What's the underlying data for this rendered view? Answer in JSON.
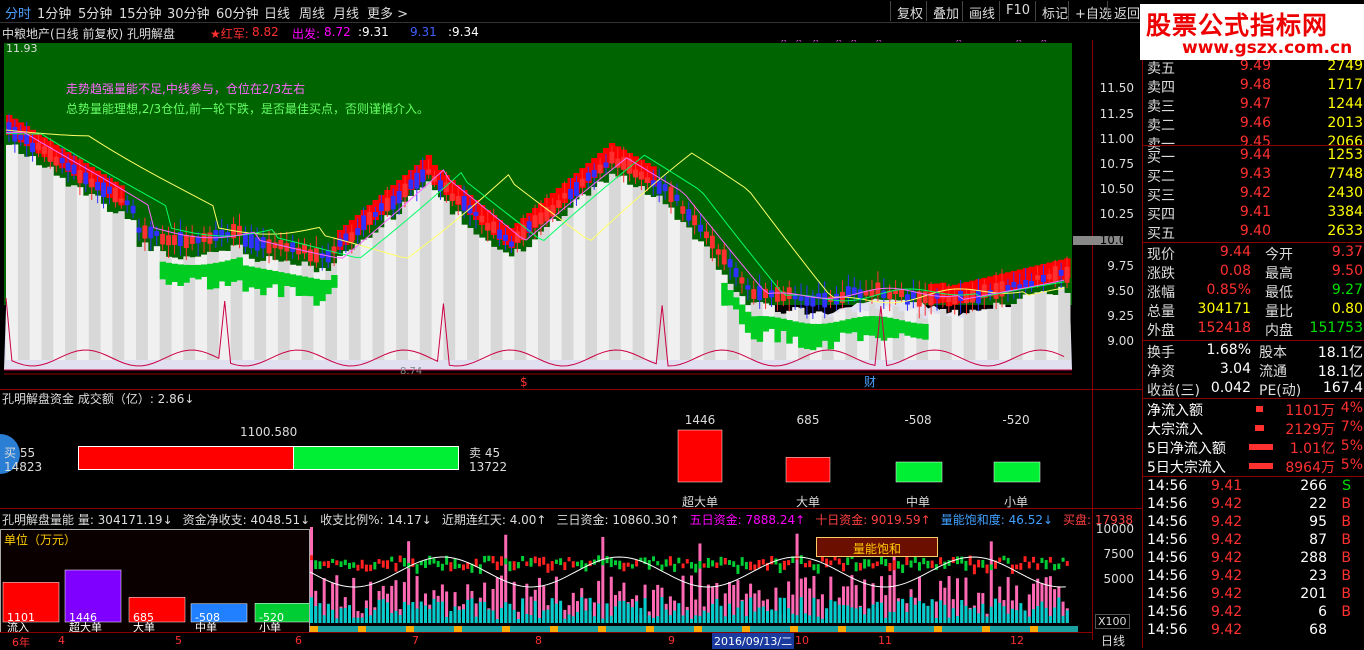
{
  "topbar": {
    "timeframes": [
      "分时",
      "1分钟",
      "5分钟",
      "15分钟",
      "30分钟",
      "60分钟",
      "日线",
      "周线",
      "月线",
      "更多 >"
    ],
    "buttons": [
      "复权",
      "叠加",
      "画线",
      "F10",
      "标记",
      "+自选",
      "返回"
    ]
  },
  "watermark": {
    "title": "股票公式指标网",
    "url": "www.gszx.com.cn"
  },
  "main": {
    "stock_name": "中粮地产(日线 前复权) 孔明解盘",
    "signal_red_label": "★红军:",
    "signal_red_value": "8.82",
    "signal_out_label": "出发:",
    "signal_out_value": "8.72",
    "v1": ":9.31",
    "v2": "9.31",
    "v3": ":9.34",
    "y_top_label": "11.93",
    "note1": "走势趋强量能不足,中线参与，仓位在2/3左右",
    "note2": "总势量能理想,2/3仓位,前一轮下跌，是否最佳买点，否则谨慎介入。",
    "price_ticks": [
      "11.50",
      "11.25",
      "11.00",
      "10.75",
      "10.50",
      "10.25",
      "10.00",
      "9.75",
      "9.50",
      "9.25",
      "9.00"
    ],
    "bottom_value": "8.74",
    "marker_s": "$",
    "marker_cai": "财"
  },
  "funds": {
    "title": "孔明解盘资金 成交额（亿）: 2.86↓",
    "buy_label": "买 55",
    "buy_value": "14823",
    "sell_label": "卖 45",
    "sell_value": "13722",
    "center_value": "1100.580",
    "bars": [
      {
        "label": "超大单",
        "value": "1446",
        "num": 1446,
        "color": "#ff0000"
      },
      {
        "label": "大单",
        "value": "685",
        "num": 685,
        "color": "#ff0000"
      },
      {
        "label": "中单",
        "value": "-508",
        "num": -508,
        "color": "#00ee33"
      },
      {
        "label": "小单",
        "value": "-520",
        "num": -520,
        "color": "#00ee33"
      }
    ]
  },
  "volume": {
    "header": [
      {
        "text": "孔明解盘量能 量: 304171.19↓",
        "color": "#ddd"
      },
      {
        "text": "资金净收支: 4048.51↓",
        "color": "#ddd"
      },
      {
        "text": "收支比例%: 14.17↓",
        "color": "#ddd"
      },
      {
        "text": "近期连红天: 4.00↑",
        "color": "#ddd"
      },
      {
        "text": "三日资金: 10860.30↑",
        "color": "#ddd"
      },
      {
        "text": "五日资金: 7888.24↑",
        "color": "#ff00ff"
      },
      {
        "text": "十日资金: 9019.59↑",
        "color": "#ff4040"
      },
      {
        "text": "量能饱和度: 46.52↓",
        "color": "#40a0ff"
      },
      {
        "text": "买盘: 17938",
        "color": "#ff4040"
      }
    ],
    "unit_label": "单位（万元）",
    "legend_bars": [
      {
        "label": "流入",
        "value": "1101",
        "color": "#ff0000",
        "num": 1101
      },
      {
        "label": "超大单",
        "value": "1446",
        "color": "#8000ff",
        "num": 1446
      },
      {
        "label": "大单",
        "value": "685",
        "color": "#ff0000",
        "num": 685
      },
      {
        "label": "中单",
        "value": "-508",
        "color": "#2080ff",
        "num": 508
      },
      {
        "label": "小单",
        "value": "-520",
        "color": "#00cc33",
        "num": 520
      }
    ],
    "saturation_label": "量能饱和",
    "ticks": [
      "10000",
      "7500",
      "5000"
    ],
    "multiplier": "X100"
  },
  "xaxis": {
    "labels": [
      "6年",
      "4",
      "5",
      "6",
      "7",
      "8",
      "9",
      "10",
      "11",
      "12"
    ],
    "selected_date": "2016/09/13/二",
    "period": "日线"
  },
  "quote": {
    "asks": [
      {
        "label": "卖五",
        "price": "9.49",
        "vol": "2749"
      },
      {
        "label": "卖四",
        "price": "9.48",
        "vol": "1717"
      },
      {
        "label": "卖三",
        "price": "9.47",
        "vol": "1244"
      },
      {
        "label": "卖二",
        "price": "9.46",
        "vol": "2013"
      },
      {
        "label": "卖一",
        "price": "9.45",
        "vol": "2066"
      }
    ],
    "bids": [
      {
        "label": "买一",
        "price": "9.44",
        "vol": "1253"
      },
      {
        "label": "买二",
        "price": "9.43",
        "vol": "7748"
      },
      {
        "label": "买三",
        "price": "9.42",
        "vol": "2430"
      },
      {
        "label": "买四",
        "price": "9.41",
        "vol": "3384"
      },
      {
        "label": "买五",
        "price": "9.40",
        "vol": "2633"
      }
    ],
    "stats": [
      [
        {
          "l": "现价",
          "v": "9.44",
          "c": "red"
        },
        {
          "l": "今开",
          "v": "9.37",
          "c": "red"
        }
      ],
      [
        {
          "l": "涨跌",
          "v": "0.08",
          "c": "red"
        },
        {
          "l": "最高",
          "v": "9.50",
          "c": "red"
        }
      ],
      [
        {
          "l": "涨幅",
          "v": "0.85%",
          "c": "red"
        },
        {
          "l": "最低",
          "v": "9.27",
          "c": "grn"
        }
      ],
      [
        {
          "l": "总量",
          "v": "304171",
          "c": "yel"
        },
        {
          "l": "量比",
          "v": "0.80",
          "c": "yel"
        }
      ],
      [
        {
          "l": "外盘",
          "v": "152418",
          "c": "red"
        },
        {
          "l": "内盘",
          "v": "151753",
          "c": "grn"
        }
      ]
    ],
    "stats2": [
      [
        {
          "l": "换手",
          "v": "1.68%",
          "c": "wht"
        },
        {
          "l": "股本",
          "v": "18.1亿",
          "c": "wht"
        }
      ],
      [
        {
          "l": "净资",
          "v": "3.04",
          "c": "wht"
        },
        {
          "l": "流通",
          "v": "18.1亿",
          "c": "wht"
        }
      ],
      [
        {
          "l": "收益(三)",
          "v": "0.042",
          "c": "wht"
        },
        {
          "l": "PE(动)",
          "v": "167.4",
          "c": "wht"
        }
      ]
    ],
    "flows": [
      {
        "l": "净流入额",
        "v": "1101万",
        "pct": "4%",
        "bar": 0.05
      },
      {
        "l": "大宗流入",
        "v": "2129万",
        "pct": "7%",
        "bar": 0.1
      },
      {
        "l": "5日净流入额",
        "v": "1.01亿",
        "pct": "5%",
        "bar": 0.4
      },
      {
        "l": "5日大宗流入",
        "v": "8964万",
        "pct": "5%",
        "bar": 0.4
      }
    ],
    "ticks": [
      {
        "t": "14:56",
        "p": "9.41",
        "v": "266",
        "s": "S"
      },
      {
        "t": "14:56",
        "p": "9.42",
        "v": "22",
        "s": "B"
      },
      {
        "t": "14:56",
        "p": "9.42",
        "v": "95",
        "s": "B"
      },
      {
        "t": "14:56",
        "p": "9.42",
        "v": "87",
        "s": "B"
      },
      {
        "t": "14:56",
        "p": "9.42",
        "v": "288",
        "s": "B"
      },
      {
        "t": "14:56",
        "p": "9.42",
        "v": "23",
        "s": "B"
      },
      {
        "t": "14:56",
        "p": "9.42",
        "v": "201",
        "s": "B"
      },
      {
        "t": "14:56",
        "p": "9.42",
        "v": "6",
        "s": "B"
      },
      {
        "t": "14:56",
        "p": "9.42",
        "v": "68",
        "s": ""
      }
    ]
  }
}
